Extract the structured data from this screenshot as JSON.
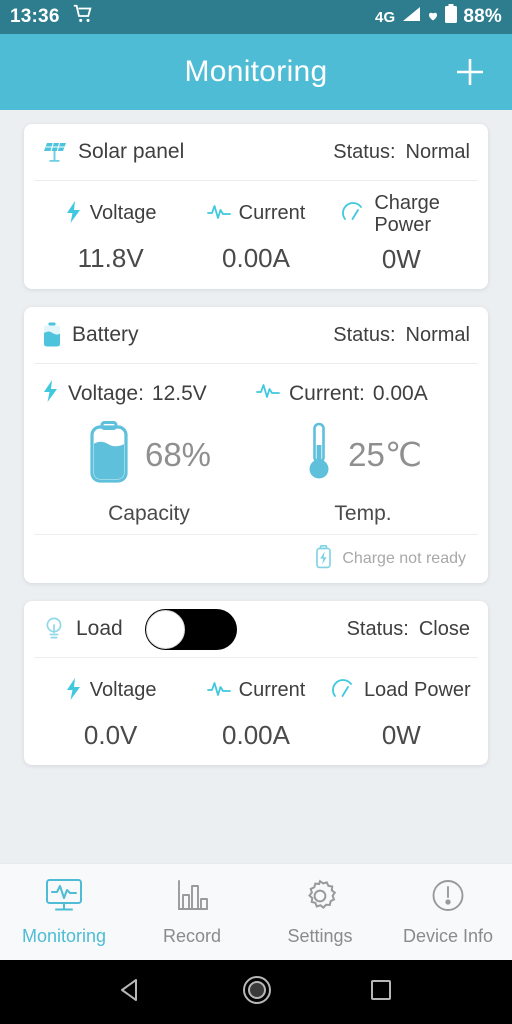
{
  "status_bar": {
    "time": "13:36",
    "cart_icon": "cart-icon",
    "network": "4G",
    "signal_icon": "signal-icon",
    "heart_icon": "heart-icon",
    "battery_icon": "battery-icon",
    "battery_level": "88%"
  },
  "app_bar": {
    "title": "Monitoring",
    "add_label": "+",
    "background": "#4ebcd5"
  },
  "cards": {
    "solar": {
      "icon": "solar-panel-icon",
      "name": "Solar panel",
      "status_label": "Status:",
      "status_value": "Normal",
      "metrics": [
        {
          "icon": "bolt-icon",
          "label": "Voltage",
          "value": "11.8V"
        },
        {
          "icon": "waveform-icon",
          "label": "Current",
          "value": "0.00A"
        },
        {
          "icon": "gauge-icon",
          "label": "Charge Power",
          "value": "0W"
        }
      ]
    },
    "battery": {
      "icon": "battery-icon",
      "name": "Battery",
      "status_label": "Status:",
      "status_value": "Normal",
      "inline": [
        {
          "icon": "bolt-icon",
          "label": "Voltage:",
          "value": "12.5V"
        },
        {
          "icon": "waveform-icon",
          "label": "Current:",
          "value": "0.00A"
        }
      ],
      "gauges": [
        {
          "icon": "battery-capacity-icon",
          "value": "68%",
          "caption": "Capacity",
          "fill_percent": 68
        },
        {
          "icon": "thermometer-icon",
          "value": "25℃",
          "caption": "Temp."
        }
      ],
      "footer": {
        "icon": "charge-battery-icon",
        "text": "Charge not ready"
      }
    },
    "load": {
      "icon": "bulb-icon",
      "name": "Load",
      "toggle_state": "off",
      "status_label": "Status:",
      "status_value": "Close",
      "metrics": [
        {
          "icon": "bolt-icon",
          "label": "Voltage",
          "value": "0.0V"
        },
        {
          "icon": "waveform-icon",
          "label": "Current",
          "value": "0.00A"
        },
        {
          "icon": "gauge-icon",
          "label": "Load Power",
          "value": "0W"
        }
      ]
    }
  },
  "bottom_nav": {
    "items": [
      {
        "icon": "monitor-pulse-icon",
        "label": "Monitoring",
        "active": true
      },
      {
        "icon": "bar-chart-icon",
        "label": "Record",
        "active": false
      },
      {
        "icon": "gear-icon",
        "label": "Settings",
        "active": false
      },
      {
        "icon": "exclamation-circle-icon",
        "label": "Device Info",
        "active": false
      }
    ],
    "active_color": "#4ebcd5",
    "inactive_color": "#8b8b8b"
  },
  "android_nav": {
    "back": "back-triangle-icon",
    "home": "home-circle-icon",
    "recents": "recents-square-icon"
  }
}
